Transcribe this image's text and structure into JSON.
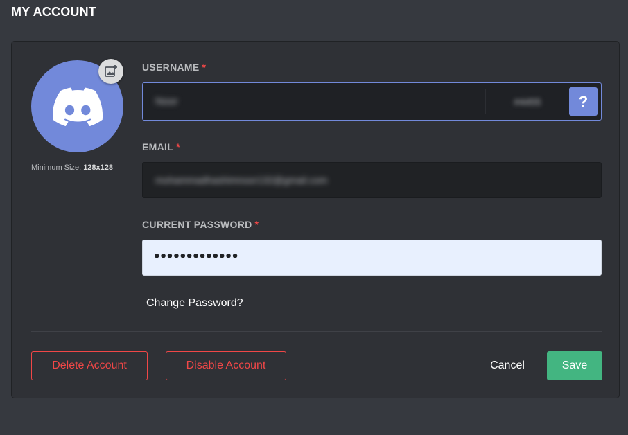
{
  "header": {
    "title": "MY ACCOUNT"
  },
  "avatar": {
    "icon": "discord-logo-icon",
    "upload_icon": "image-add-icon",
    "min_size_label": "Minimum Size:",
    "min_size_value": "128x128"
  },
  "form": {
    "required_marker": "*",
    "username": {
      "label": "USERNAME",
      "value": "Noor",
      "tag": "#4455",
      "help_label": "?"
    },
    "email": {
      "label": "EMAIL",
      "value": "mohammadhashimnoor132@gmail.com"
    },
    "current_password": {
      "label": "CURRENT PASSWORD",
      "value": "•••••••••••••"
    },
    "change_password_link": "Change Password?"
  },
  "actions": {
    "delete_label": "Delete Account",
    "disable_label": "Disable Account",
    "cancel_label": "Cancel",
    "save_label": "Save"
  },
  "colors": {
    "background": "#36393f",
    "panel": "#2f3136",
    "blurple": "#7289da",
    "danger": "#f04747",
    "success": "#43b581"
  }
}
